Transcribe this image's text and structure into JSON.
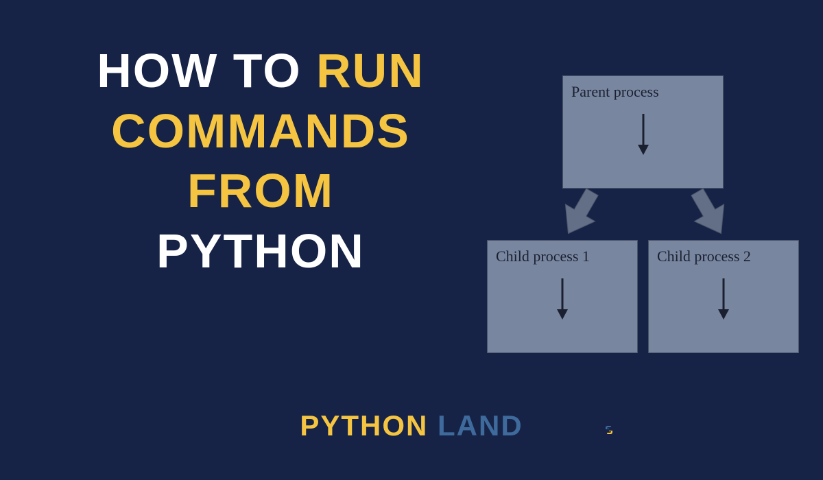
{
  "title": {
    "line1_left": "HOW TO ",
    "line1_right": "RUN",
    "line2": "COMMANDS",
    "line3": "FROM",
    "line4": "PYTHON"
  },
  "brand": {
    "word1": "PYTHON",
    "word2": "LAND"
  },
  "diagram": {
    "parent_label": "Parent process",
    "child1_label": "Child process 1",
    "child2_label": "Child process 2"
  },
  "colors": {
    "background": "#162346",
    "white": "#ffffff",
    "yellow": "#f5c542",
    "blue": "#3e6a9c",
    "box_fill": "#7986a0",
    "box_border": "#4a5468",
    "box_text": "#1a2030",
    "arrow_fill": "#636f87"
  }
}
